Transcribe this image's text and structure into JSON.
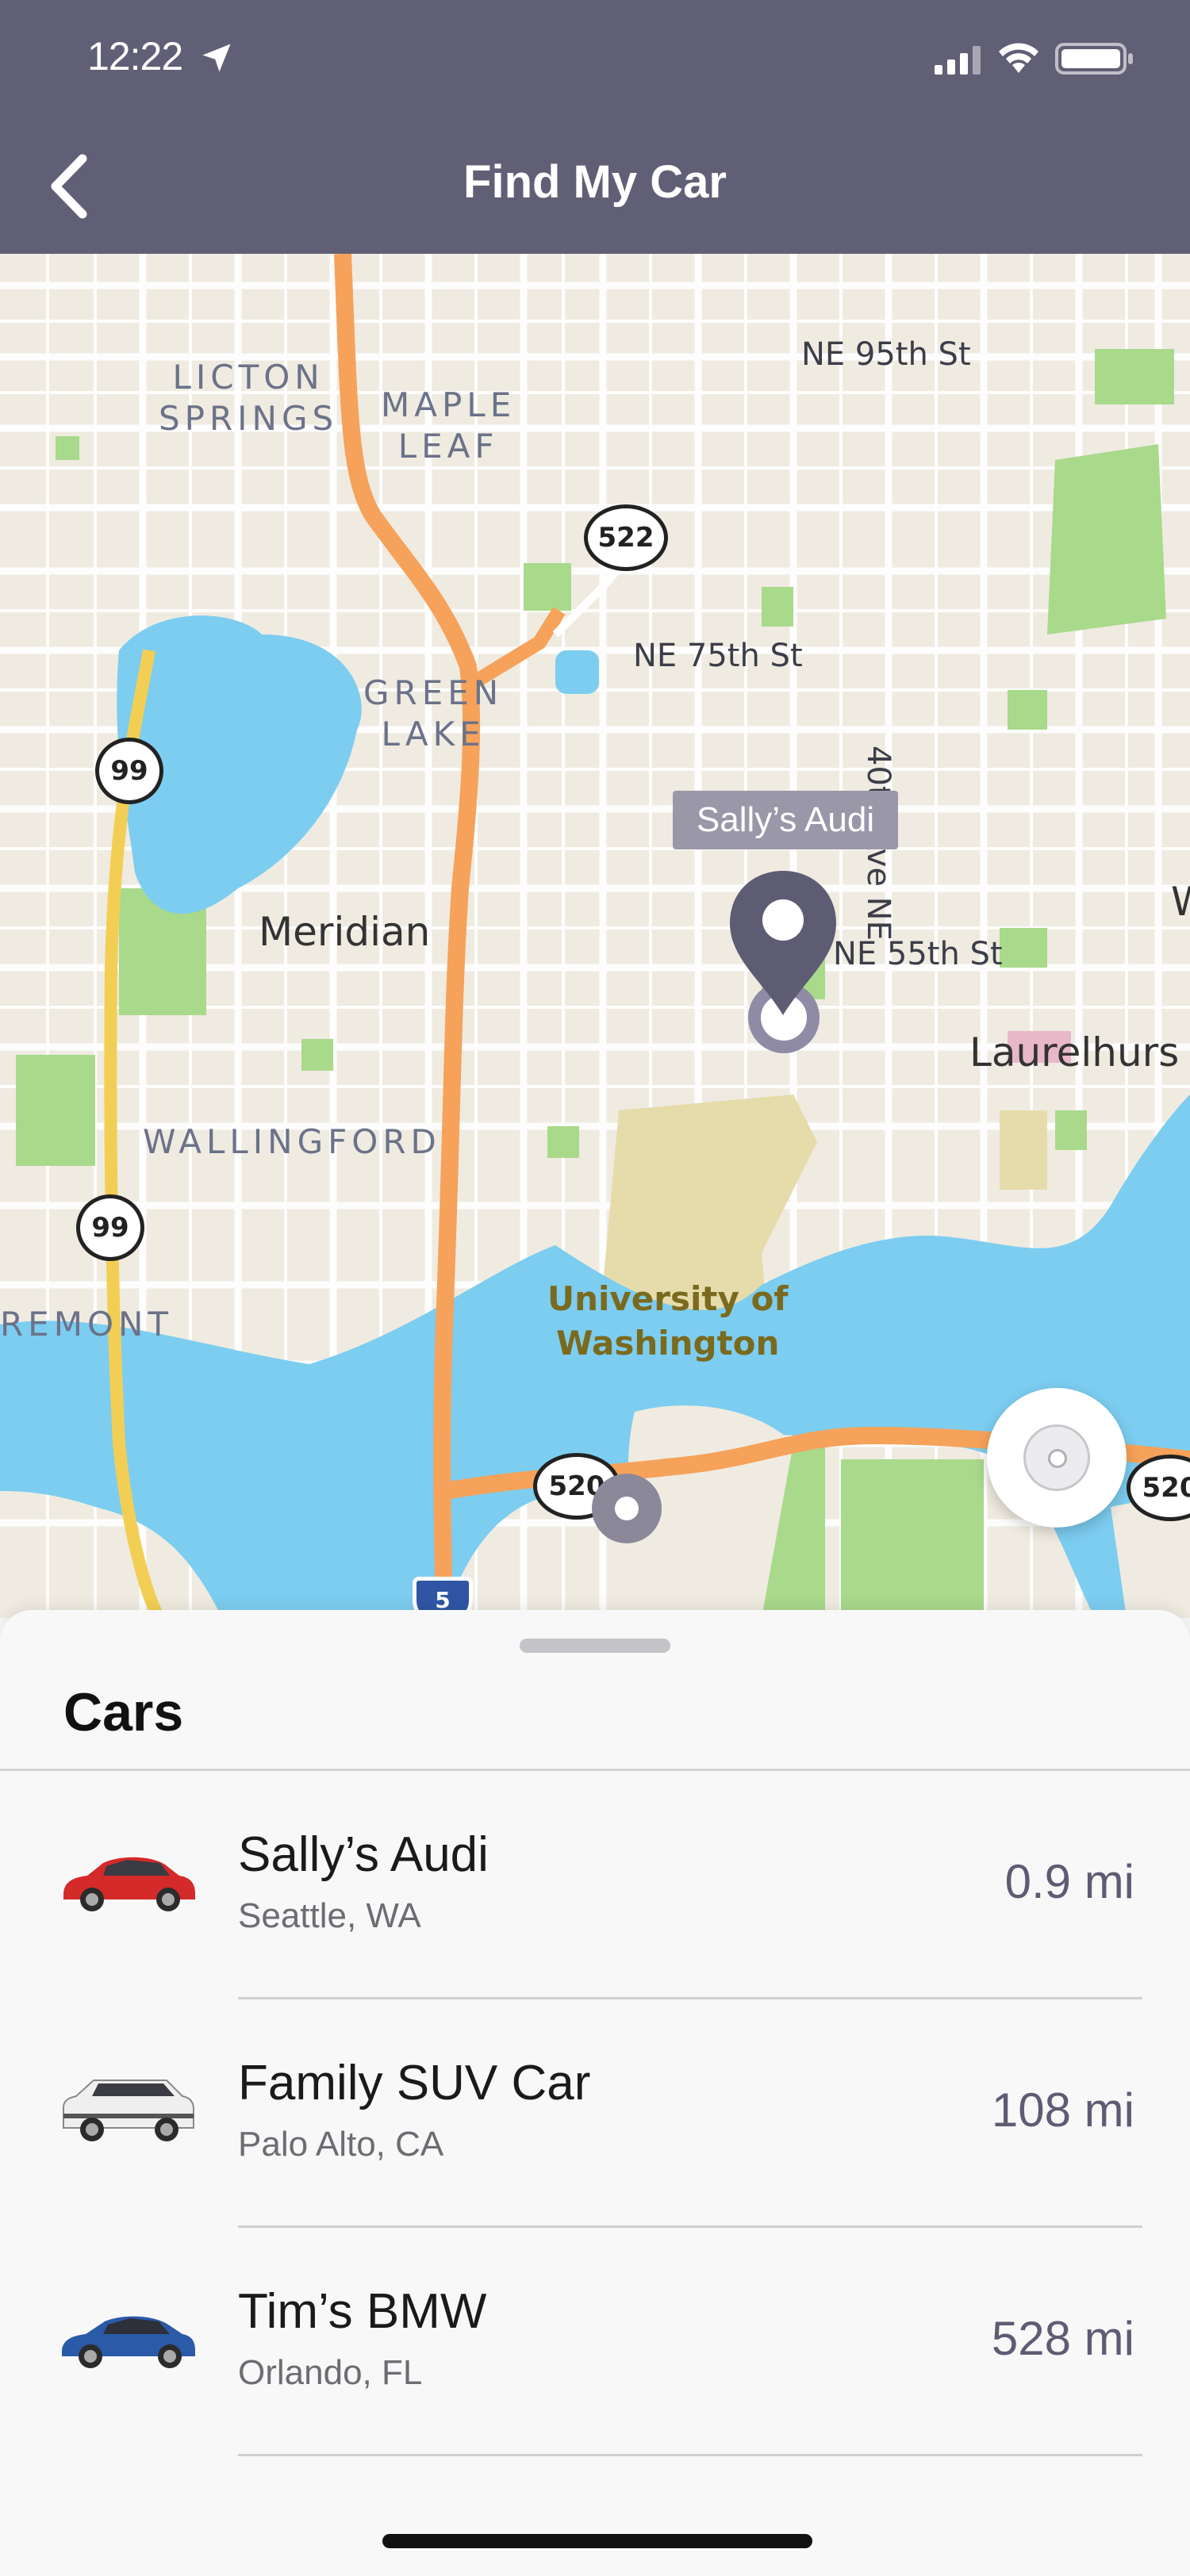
{
  "status_bar": {
    "time": "12:22"
  },
  "header": {
    "title": "Find My Car"
  },
  "map": {
    "neighborhoods": {
      "licton_springs": "LICTON\nSPRINGS",
      "maple_leaf": "MAPLE\nLEAF",
      "green_lake": "GREEN\nLAKE",
      "wallingford": "WALLINGFORD",
      "fremont": "REMONT"
    },
    "places": {
      "meridian": "Meridian",
      "laurelhurst": "Laurelhurs",
      "uw": "University of\nWashington",
      "edge_w": "W"
    },
    "streets": {
      "ne95": "NE 95th St",
      "ne75": "NE 75th St",
      "ne55": "NE 55th St",
      "ave40": "40th Ave NE"
    },
    "shields": {
      "sr522": "522",
      "sr99_top": "99",
      "sr99_bottom": "99",
      "sr520": "520",
      "sr520_edge": "520",
      "i5": "5"
    },
    "selected_car_callout": "Sally’s Audi"
  },
  "sheet": {
    "title": "Cars",
    "cars": [
      {
        "name": "Sally’s Audi",
        "location": "Seattle, WA",
        "distance": "0.9 mi",
        "color": "#d42a2a"
      },
      {
        "name": "Family SUV Car",
        "location": "Palo Alto, CA",
        "distance": "108 mi",
        "color": "#f2f2f2"
      },
      {
        "name": "Tim’s BMW",
        "location": "Orlando, FL",
        "distance": "528 mi",
        "color": "#2a5aa8"
      }
    ]
  },
  "colors": {
    "header": "#615f75",
    "accent": "#5e5c73",
    "water": "#7ccdf0",
    "park": "#a9d98b",
    "highway": "#f6a25a"
  }
}
